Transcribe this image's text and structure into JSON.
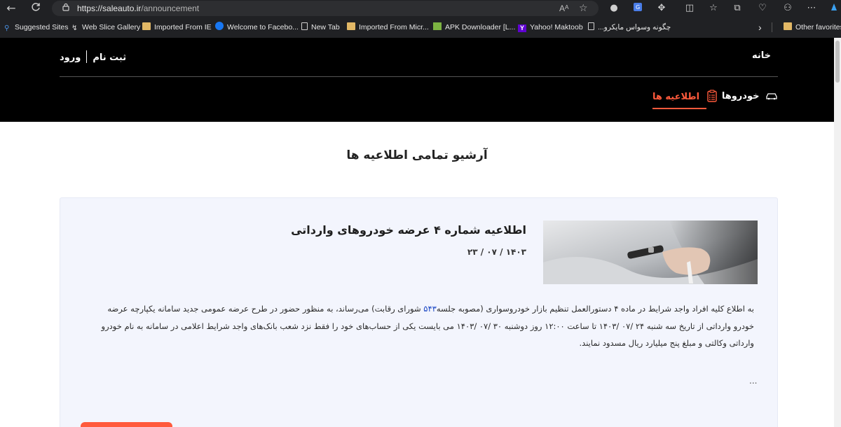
{
  "browser": {
    "url_host": "https://saleauto.ir",
    "url_path": "/announcement",
    "reader_label": "Aᴬ"
  },
  "bookmarks": {
    "items": [
      {
        "label": "Suggested Sites"
      },
      {
        "label": "Web Slice Gallery"
      },
      {
        "label": "Imported From IE"
      },
      {
        "label": "Welcome to Facebo..."
      },
      {
        "label": "New Tab"
      },
      {
        "label": "Imported From Micr..."
      },
      {
        "label": "APK Downloader [L..."
      },
      {
        "label": "Yahoo! Maktoob"
      },
      {
        "label": "چگونه وسواس مایکرو..."
      }
    ],
    "other_favorites": "Other favorites"
  },
  "header": {
    "home_link": "خانه",
    "login_link": "ورود",
    "register_link": "ثبت نام",
    "nav_cars": "خودروها",
    "nav_announcements": "اطلاعیه ها"
  },
  "main": {
    "heading": "آرشیو تمامی اطلاعیه ها",
    "announcement": {
      "title": "اطلاعیه شماره ۴ عرضه خودروهای وارداتی",
      "date": "۱۴۰۳ / ۰۷ / ۲۳",
      "body_before": "به اطلاع کلیه افراد واجد شرایط در ماده ۴ دستورالعمل تنظیم بازار خودروسواری (مصوبه جلسه",
      "body_highlight": "۵۴۳",
      "body_after": " شورای رقابت) می‌رساند، به منظور حضور در طرح عرضه عمومی جدید سامانه یکپارچه عرضه خودرو وارداتی از تاریخ سه شنبه ۲۴ /۰۷ /۱۴۰۳ تا ساعت ۱۲:۰۰ روز دوشنبه ۳۰ /۰۷ /۱۴۰۳ می بایست یکی از حساب‌های خود را فقط نزد شعب بانک‌های واجد شرایط اعلامی در سامانه  به نام خودرو وارداتی وکالتی و مبلغ پنج میلیارد ریال مسدود نمایند.",
      "more": "...",
      "accent_color": "#ff5a3c"
    }
  }
}
